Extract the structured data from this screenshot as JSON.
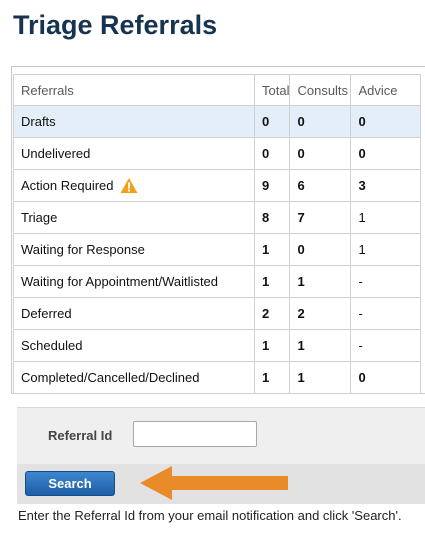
{
  "page": {
    "title": "Triage Referrals"
  },
  "table": {
    "headers": [
      "Referrals",
      "Total",
      "Consults",
      "Advice"
    ],
    "rows": [
      {
        "label": "Drafts",
        "total": "0",
        "consults": "0",
        "advice": "0"
      },
      {
        "label": "Undelivered",
        "total": "0",
        "consults": "0",
        "advice": "0"
      },
      {
        "label": "Action Required",
        "total": "9",
        "consults": "6",
        "advice": "3"
      },
      {
        "label": "Triage",
        "total": "8",
        "consults": "7",
        "advice": "1"
      },
      {
        "label": "Waiting for Response",
        "total": "1",
        "consults": "0",
        "advice": "1"
      },
      {
        "label": "Waiting for Appointment/Waitlisted",
        "total": "1",
        "consults": "1",
        "advice": "-"
      },
      {
        "label": "Deferred",
        "total": "2",
        "consults": "2",
        "advice": "-"
      },
      {
        "label": "Scheduled",
        "total": "1",
        "consults": "1",
        "advice": "-"
      },
      {
        "label": "Completed/Cancelled/Declined",
        "total": "1",
        "consults": "1",
        "advice": "0"
      }
    ]
  },
  "icons": {
    "action_required": "warning-icon",
    "annotation": "arrow-left-icon"
  },
  "search": {
    "label": "Referral Id",
    "value": "",
    "placeholder": "",
    "button_label": "Search",
    "help_text": "Enter the Referral Id from your email notification and click 'Search'."
  },
  "colors": {
    "title": "#16344f",
    "highlight_row": "#e3eef9",
    "button": "#2a6fb8",
    "warning": "#f2a11d",
    "annotation_arrow": "#ea8b2a"
  }
}
